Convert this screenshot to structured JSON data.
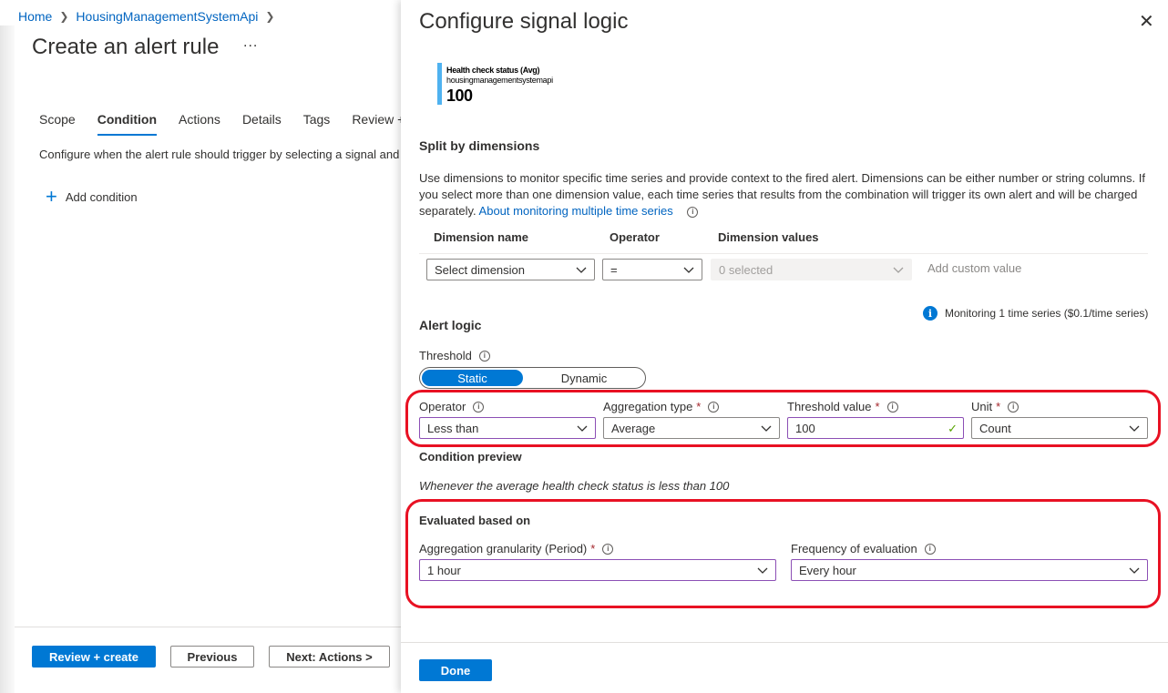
{
  "breadcrumb": {
    "home": "Home",
    "resource": "HousingManagementSystemApi"
  },
  "left": {
    "title": "Create an alert rule",
    "more": "...",
    "tabs": [
      "Scope",
      "Condition",
      "Actions",
      "Details",
      "Tags",
      "Review +"
    ],
    "active_tab": "Condition",
    "description": "Configure when the alert rule should trigger by selecting a signal and",
    "add_condition": "Add condition",
    "buttons": {
      "review_create": "Review + create",
      "previous": "Previous",
      "next": "Next: Actions >"
    }
  },
  "panel": {
    "title": "Configure signal logic",
    "mini_chart": {
      "title": "Health check status (Avg)",
      "subtitle": "housingmanagementsystemapi",
      "value": "100",
      "color": "#4fb2f0"
    },
    "split": {
      "heading": "Split by dimensions",
      "description": "Use dimensions to monitor specific time series and provide context to the fired alert. Dimensions can be either number or string columns. If you select more than one dimension value, each time series that results from the combination will trigger its own alert and will be charged separately.",
      "link": "About monitoring multiple time series",
      "headers": {
        "name": "Dimension name",
        "operator": "Operator",
        "values": "Dimension values"
      },
      "row": {
        "dimension": "Select dimension",
        "operator": "=",
        "values": "0 selected",
        "custom_placeholder": "Add custom value"
      }
    },
    "monitoring": "Monitoring 1 time series ($0.1/time series)",
    "alert_logic": {
      "heading": "Alert logic",
      "threshold_label": "Threshold",
      "toggle": {
        "static": "Static",
        "dynamic": "Dynamic"
      },
      "operator_label": "Operator",
      "operator_value": "Less than",
      "aggregation_label": "Aggregation type",
      "aggregation_value": "Average",
      "threshold_value_label": "Threshold value",
      "threshold_value": "100",
      "unit_label": "Unit",
      "unit_value": "Count",
      "required_mark": "*"
    },
    "preview": {
      "heading": "Condition preview",
      "text": "Whenever the average health check status is less than 100"
    },
    "evaluation": {
      "heading": "Evaluated based on",
      "granularity_label": "Aggregation granularity (Period)",
      "granularity_value": "1 hour",
      "frequency_label": "Frequency of evaluation",
      "frequency_value": "Every hour"
    },
    "done": "Done",
    "colors": {
      "accent": "#0078d4",
      "highlight": "#e81123",
      "field_border": "#8c4fb5"
    }
  }
}
